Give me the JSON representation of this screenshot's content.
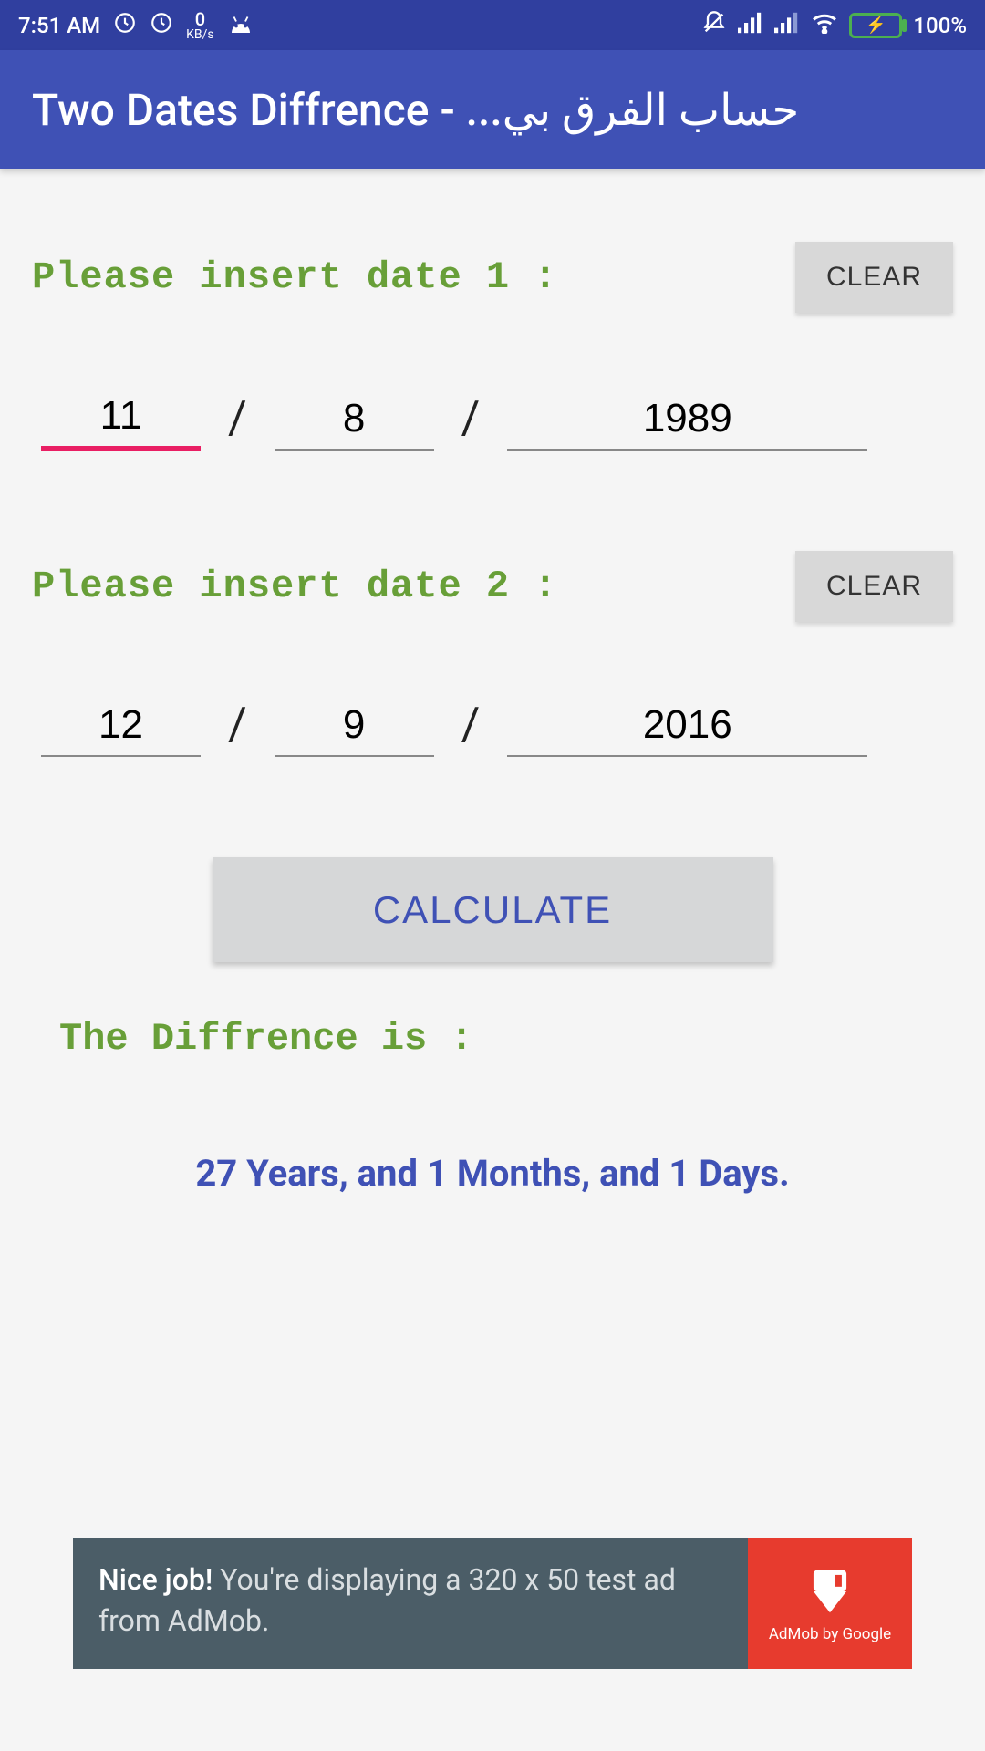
{
  "status": {
    "time": "7:51 AM",
    "kbps_num": "0",
    "kbps_unit": "KB/s",
    "battery_pct": "100%"
  },
  "app": {
    "title": "Two Dates Diffrence - ...حساب الفرق بي"
  },
  "labels": {
    "prompt1": "Please insert date 1 :",
    "prompt2": "Please insert date 2 :",
    "clear": "CLEAR",
    "calculate": "CALCULATE",
    "result_label": "The Diffrence is :",
    "sep": "/"
  },
  "date1": {
    "day": "11",
    "month": "8",
    "year": "1989"
  },
  "date2": {
    "day": "12",
    "month": "9",
    "year": "2016"
  },
  "result": "27 Years, and 1 Months, and 1 Days.",
  "ad": {
    "bold": "Nice job!",
    "rest": " You're displaying a 320 x 50 test ad from AdMob.",
    "caption": "AdMob by Google"
  }
}
